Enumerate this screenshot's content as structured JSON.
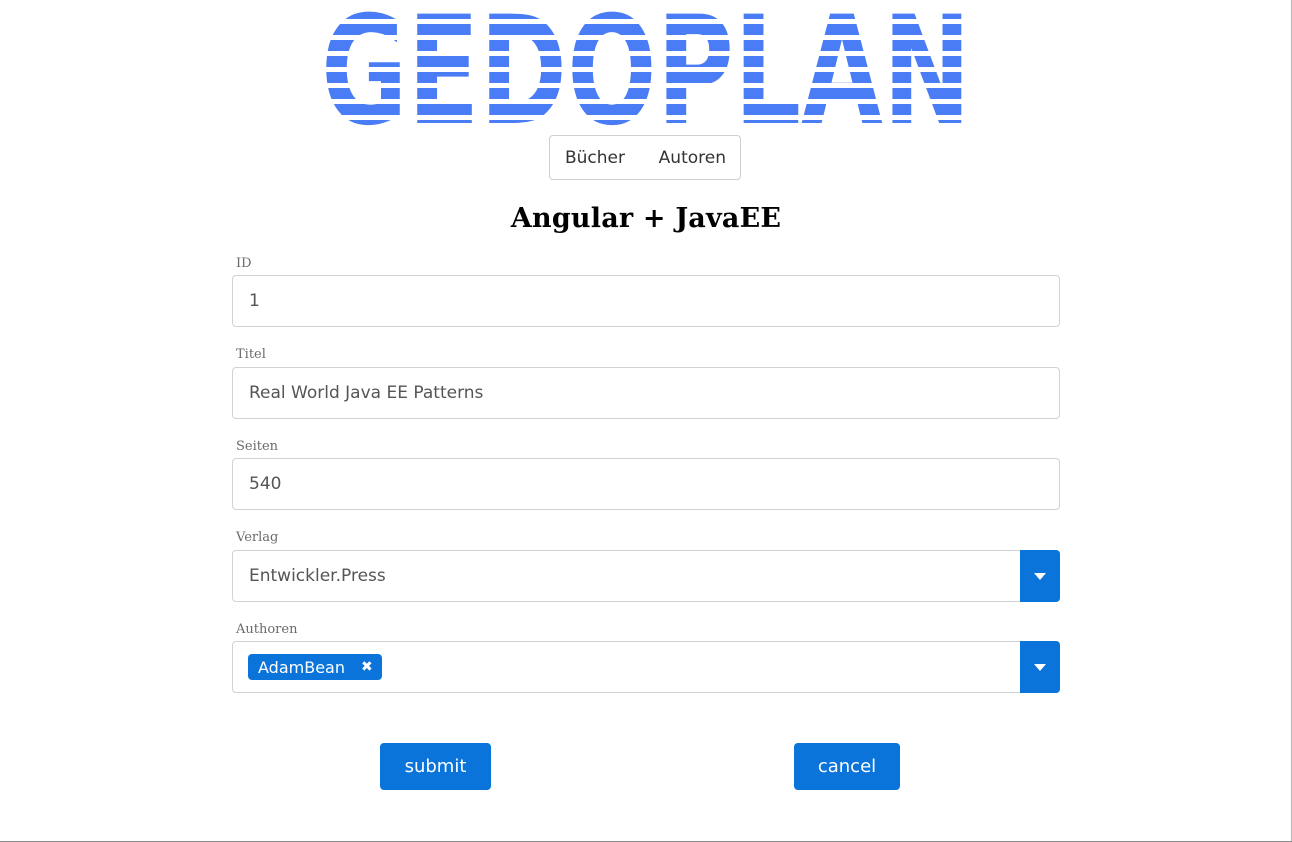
{
  "logo": {
    "text": "GEDOPLAN",
    "color": "#4a7df5"
  },
  "nav": {
    "items": [
      {
        "label": "Bücher"
      },
      {
        "label": "Autoren"
      }
    ]
  },
  "page_title": "Angular + JavaEE",
  "form": {
    "id": {
      "label": "ID",
      "value": "1"
    },
    "title": {
      "label": "Titel",
      "value": "Real World Java EE Patterns"
    },
    "pages": {
      "label": "Seiten",
      "value": "540"
    },
    "publisher": {
      "label": "Verlag",
      "value": "Entwickler.Press"
    },
    "authors": {
      "label": "Authoren",
      "selected": [
        {
          "name": "AdamBean"
        }
      ]
    }
  },
  "actions": {
    "submit_label": "submit",
    "cancel_label": "cancel"
  },
  "colors": {
    "accent": "#0a74da",
    "logo": "#4a7df5",
    "border": "#cfd3d8"
  }
}
